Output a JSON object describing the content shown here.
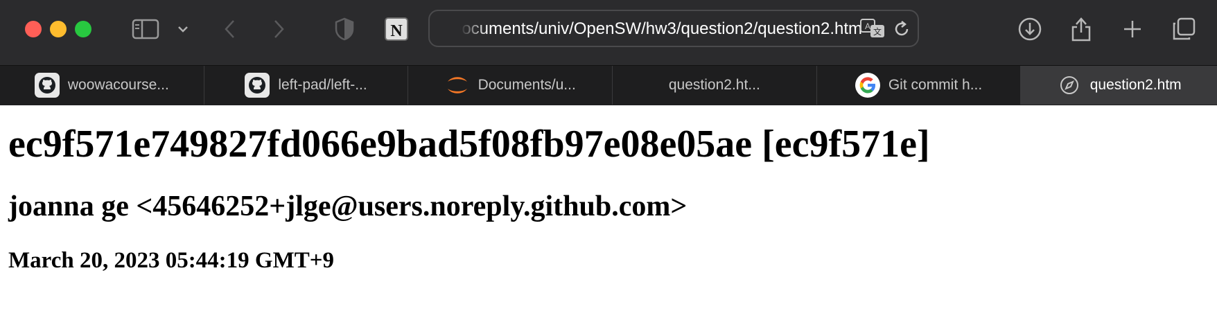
{
  "browser": {
    "url": "Documents/univ/OpenSW/hw3/question2/question2.htm",
    "tabs": [
      {
        "label": "woowacourse...",
        "icon": "github-icon"
      },
      {
        "label": "left-pad/left-...",
        "icon": "github-icon"
      },
      {
        "label": "Documents/u...",
        "icon": "jupyter-icon"
      },
      {
        "label": "question2.ht...",
        "icon": ""
      },
      {
        "label": "Git commit h...",
        "icon": "google-icon"
      },
      {
        "label": "question2.htm",
        "icon": "compass-icon",
        "active": true
      }
    ]
  },
  "page": {
    "commit_heading": "ec9f571e749827fd066e9bad5f08fb97e08e05ae [ec9f571e]",
    "author": "joanna ge <45646252+jlge@users.noreply.github.com>",
    "date": "March 20, 2023 05:44:19 GMT+9"
  }
}
